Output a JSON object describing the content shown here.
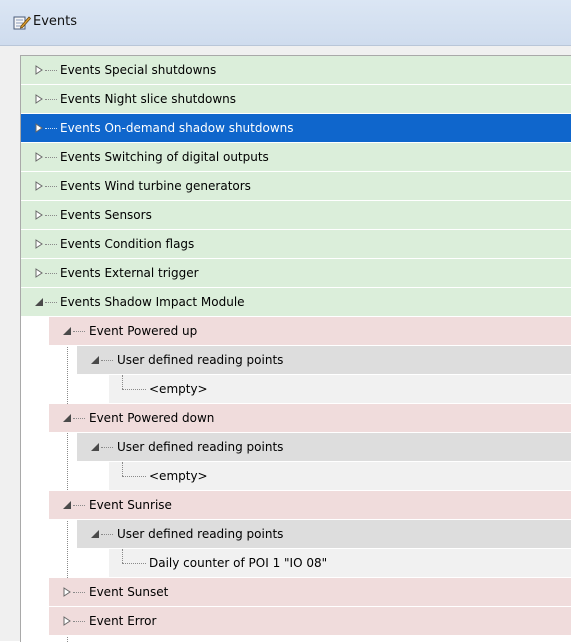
{
  "window": {
    "title": "Events",
    "icon": "pencil-notepad-icon"
  },
  "tree": {
    "groups": [
      {
        "label": "Events Special shutdowns"
      },
      {
        "label": "Events Night slice shutdowns"
      },
      {
        "label": "Events On-demand shadow shutdowns",
        "selected": true
      },
      {
        "label": "Events Switching of digital outputs"
      },
      {
        "label": "Events Wind turbine generators"
      },
      {
        "label": "Events Sensors"
      },
      {
        "label": "Events Condition flags"
      },
      {
        "label": "Events External trigger"
      },
      {
        "label": "Events Shadow Impact Module",
        "expanded": true
      }
    ],
    "sim_events": [
      {
        "label": "Event Powered up",
        "child": {
          "label": "User defined reading points",
          "leaf": "<empty>"
        }
      },
      {
        "label": "Event Powered down",
        "child": {
          "label": "User defined reading points",
          "leaf": "<empty>"
        }
      },
      {
        "label": "Event Sunrise",
        "child": {
          "label": "User defined reading points",
          "leaf": "Daily counter of POI 1 \"IO 08\""
        }
      },
      {
        "label": "Event Sunset"
      },
      {
        "label": "Event Error"
      }
    ]
  },
  "colors": {
    "group_row": "#dbeeda",
    "selected_row": "#0f66cc",
    "event_row": "#f0dcdc",
    "subnode_row": "#dddddd",
    "leaf_row": "#f1f1f1"
  }
}
